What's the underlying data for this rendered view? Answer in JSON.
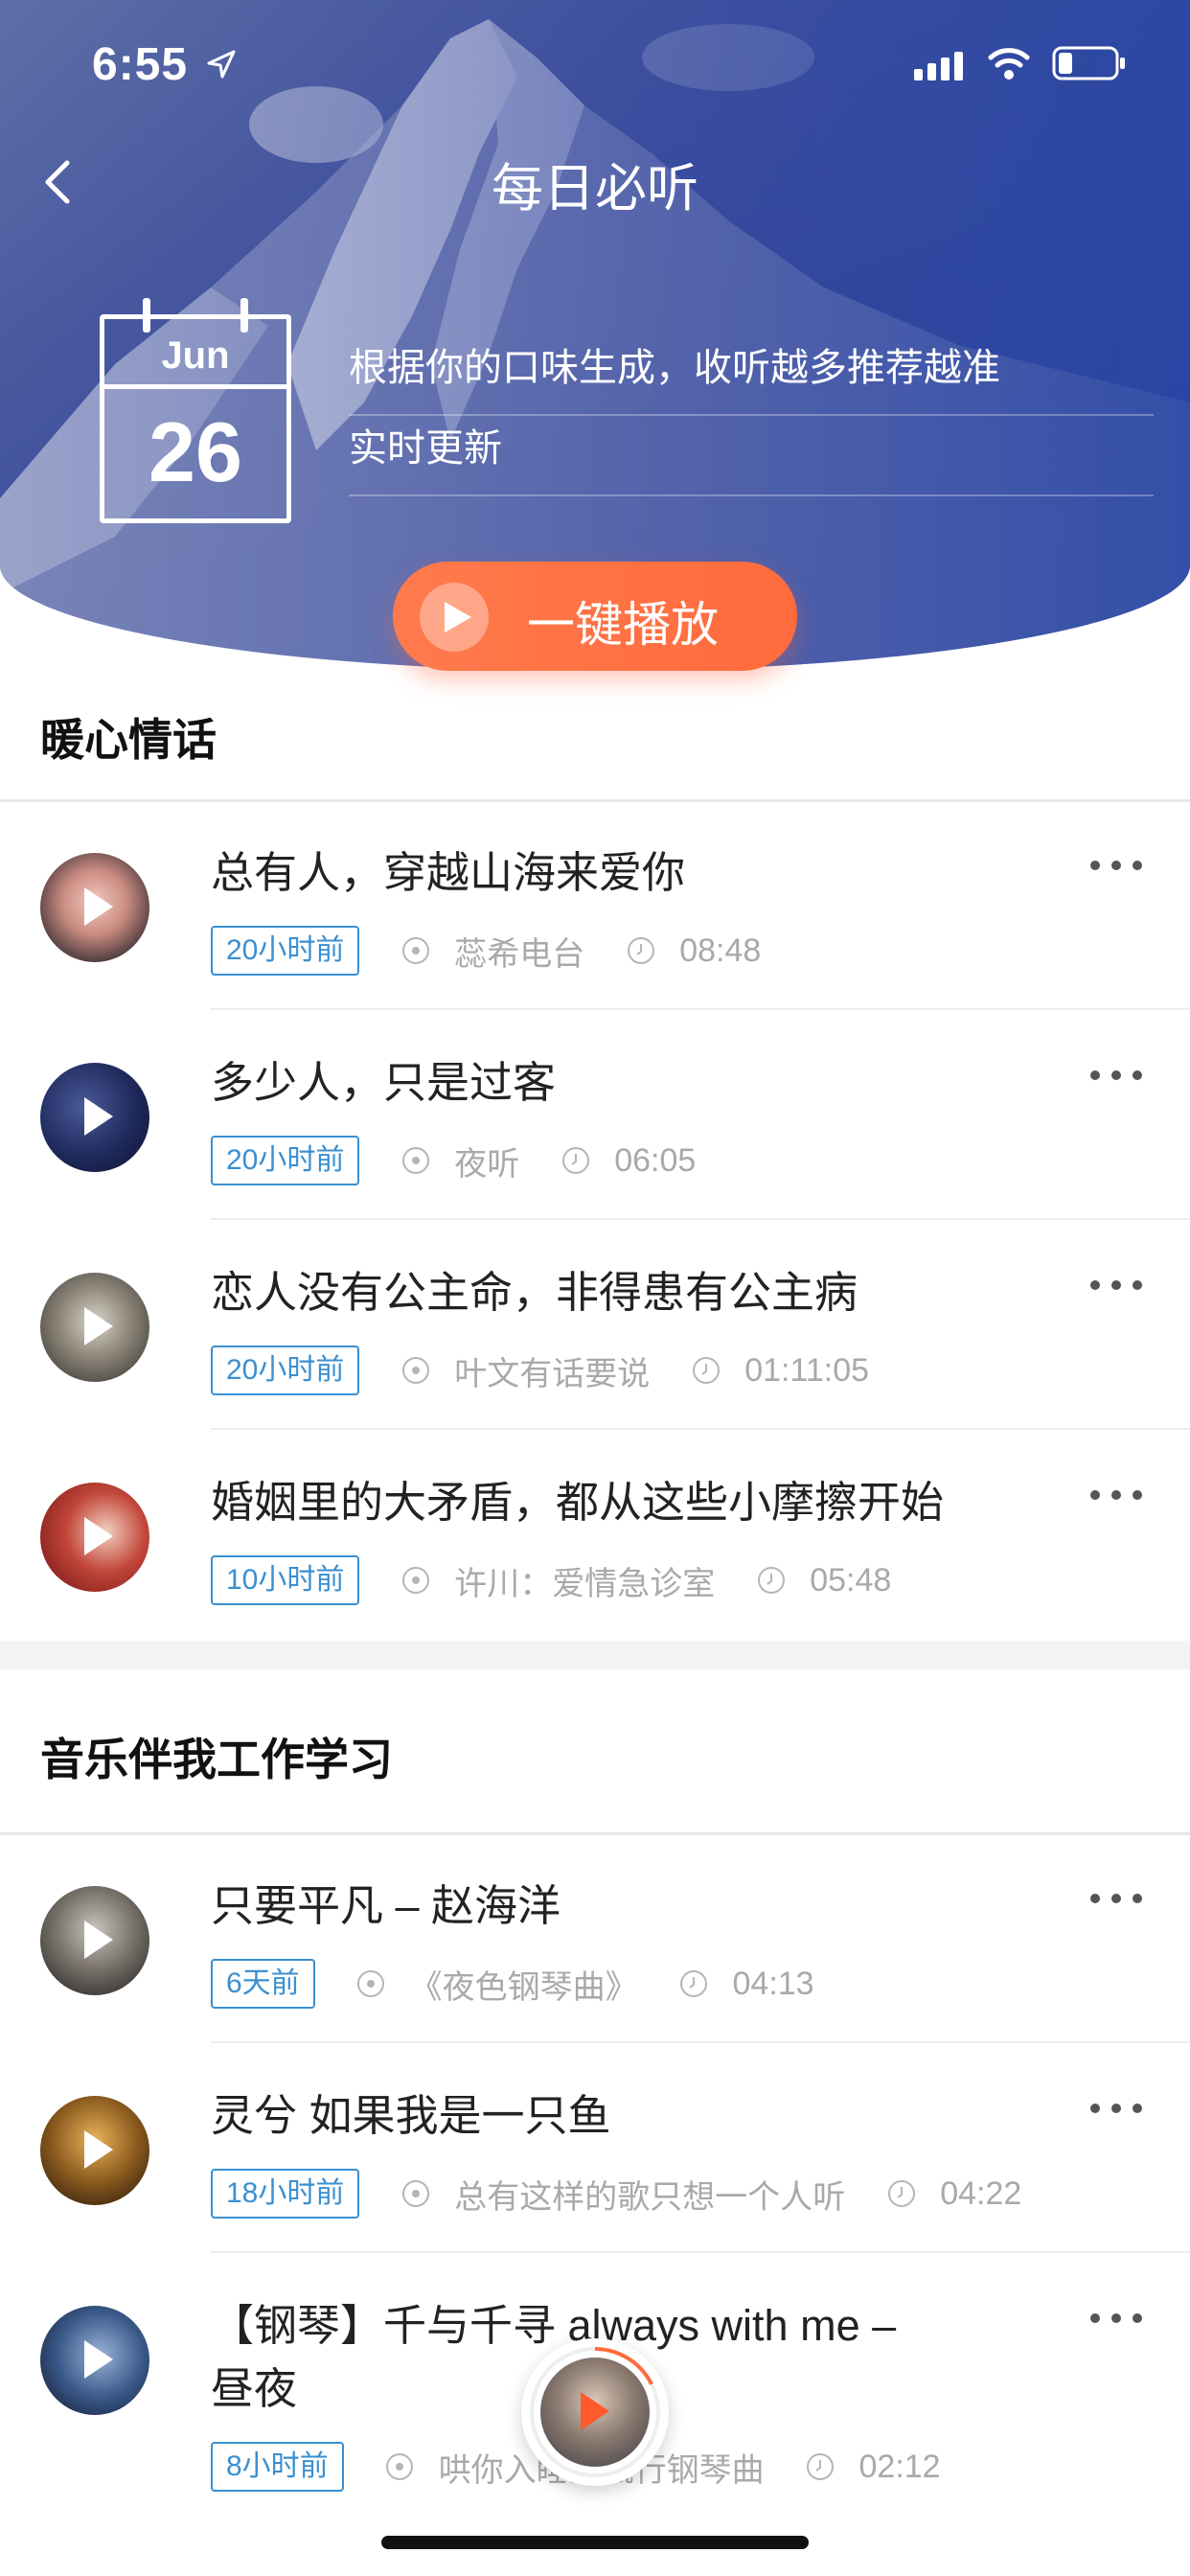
{
  "status_bar": {
    "time": "6:55"
  },
  "header": {
    "title": "每日必听",
    "calendar": {
      "month": "Jun",
      "day": "26"
    },
    "description": "根据你的口味生成，收听越多推荐越准",
    "update_text": "实时更新",
    "play_all_label": "一键播放"
  },
  "colors": {
    "accent": "#ff6b3d",
    "tag": "#3a8fd0",
    "header_blue": "#3a4d9b"
  },
  "sections": [
    {
      "title": "暖心情话",
      "items": [
        {
          "title": "总有人，穿越山海来爱你",
          "tag": "20小时前",
          "source": "蕊希电台",
          "duration": "08:48"
        },
        {
          "title": "多少人，只是过客",
          "tag": "20小时前",
          "source": "夜听",
          "duration": "06:05"
        },
        {
          "title": "恋人没有公主命，非得患有公主病",
          "tag": "20小时前",
          "source": "叶文有话要说",
          "duration": "01:11:05"
        },
        {
          "title": "婚姻里的大矛盾，都从这些小摩擦开始",
          "tag": "10小时前",
          "source": "许川：爱情急诊室",
          "duration": "05:48"
        }
      ]
    },
    {
      "title": "音乐伴我工作学习",
      "items": [
        {
          "title": "只要平凡 – 赵海洋",
          "tag": "6天前",
          "source": "《夜色钢琴曲》",
          "duration": "04:13"
        },
        {
          "title": "灵兮 如果我是一只鱼",
          "tag": "18小时前",
          "source": "总有这样的歌只想一个人听",
          "duration": "04:22"
        },
        {
          "title": "【钢琴】千与千寻 always with me –\n昼夜",
          "tag": "8小时前",
          "source": "哄你入睡的流行钢琴曲",
          "duration": "02:12"
        }
      ]
    }
  ]
}
